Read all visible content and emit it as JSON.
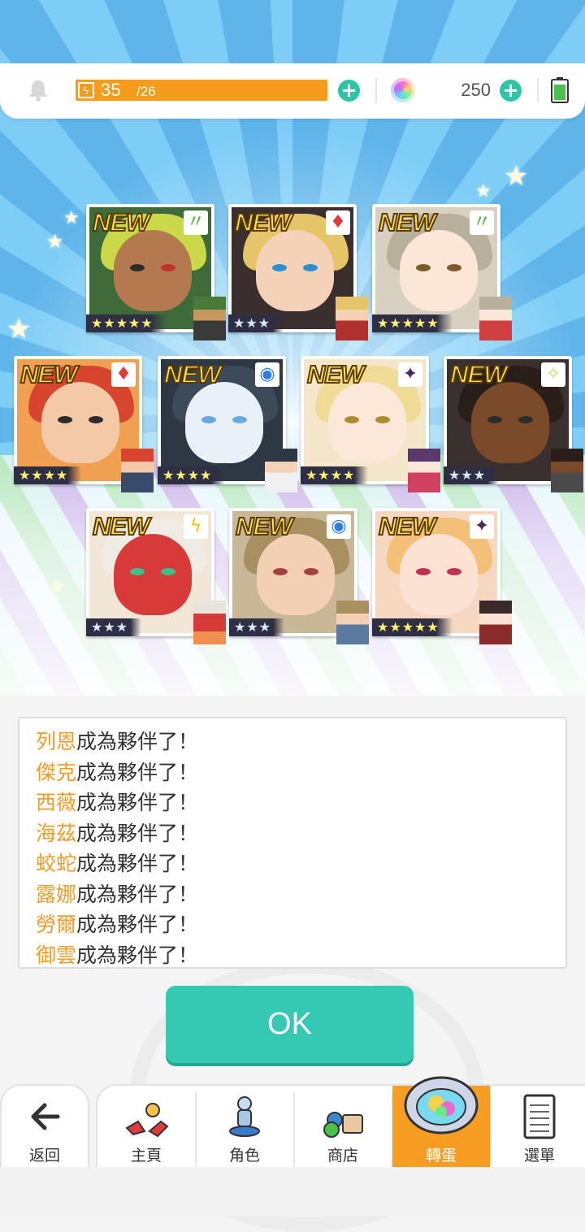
{
  "status_bar": {
    "stamina_current": "35",
    "stamina_max": "/26",
    "gem_count": "250",
    "colors": {
      "stamina": "#f59c1a",
      "accent": "#2ec4a4"
    }
  },
  "cards": [
    {
      "new_label": "NEW",
      "attribute": "wind",
      "stars": "★★★★★"
    },
    {
      "new_label": "NEW",
      "attribute": "fire",
      "stars": "★★★"
    },
    {
      "new_label": "NEW",
      "attribute": "wind",
      "stars": "★★★★★"
    },
    {
      "new_label": "NEW",
      "attribute": "fire",
      "stars": "★★★★"
    },
    {
      "new_label": "NEW",
      "attribute": "water",
      "stars": "★★★★"
    },
    {
      "new_label": "NEW",
      "attribute": "dark",
      "stars": "★★★★"
    },
    {
      "new_label": "NEW",
      "attribute": "light",
      "stars": "★★★"
    },
    {
      "new_label": "NEW",
      "attribute": "thunder",
      "stars": "★★★"
    },
    {
      "new_label": "NEW",
      "attribute": "water",
      "stars": "★★★"
    },
    {
      "new_label": "NEW",
      "attribute": "dark",
      "stars": "★★★★★"
    }
  ],
  "log": {
    "suffix": "成為夥伴了！",
    "entries": [
      {
        "name": "列恩",
        "text": "成為夥伴了！"
      },
      {
        "name": "傑克",
        "text": "成為夥伴了！"
      },
      {
        "name": "西薇",
        "text": "成為夥伴了！"
      },
      {
        "name": "海茲",
        "text": "成為夥伴了！"
      },
      {
        "name": "蛟蛇",
        "text": "成為夥伴了！"
      },
      {
        "name": "露娜",
        "text": "成為夥伴了！"
      },
      {
        "name": "勞爾",
        "text": "成為夥伴了！"
      },
      {
        "name": "御雲",
        "text": "成為夥伴了！"
      }
    ]
  },
  "ok_button": {
    "label": "OK"
  },
  "nav": {
    "back": {
      "label": "返回",
      "icon": "arrow-left-icon"
    },
    "items": [
      {
        "label": "主頁",
        "icon": "home-icon",
        "active": false
      },
      {
        "label": "角色",
        "icon": "character-icon",
        "active": false
      },
      {
        "label": "商店",
        "icon": "shop-icon",
        "active": false
      },
      {
        "label": "轉蛋",
        "icon": "gacha-icon",
        "active": true
      },
      {
        "label": "選單",
        "icon": "menu-icon",
        "active": false
      }
    ]
  }
}
